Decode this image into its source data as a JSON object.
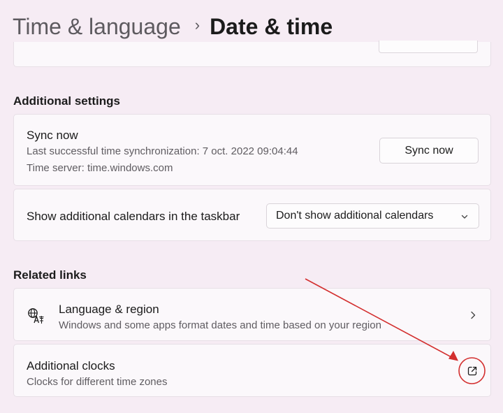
{
  "breadcrumb": {
    "parent": "Time & language",
    "separator": "›",
    "current": "Date & time"
  },
  "additional_settings": {
    "title": "Additional settings",
    "sync": {
      "title": "Sync now",
      "last_sync": "Last successful time synchronization: 7 oct. 2022 09:04:44",
      "time_server": "Time server: time.windows.com",
      "button_label": "Sync now"
    },
    "calendars": {
      "label": "Show additional calendars in the taskbar",
      "selected": "Don't show additional calendars"
    }
  },
  "related_links": {
    "title": "Related links",
    "items": [
      {
        "title": "Language & region",
        "subtitle": "Windows and some apps format dates and time based on your region",
        "icon": "language-icon",
        "action_icon": "chevron-right-icon"
      },
      {
        "title": "Additional clocks",
        "subtitle": "Clocks for different time zones",
        "action_icon": "external-link-icon"
      }
    ]
  },
  "colors": {
    "background": "#f6ecf4",
    "card": "#fbf8fb",
    "annotation": "#d32f2f"
  }
}
